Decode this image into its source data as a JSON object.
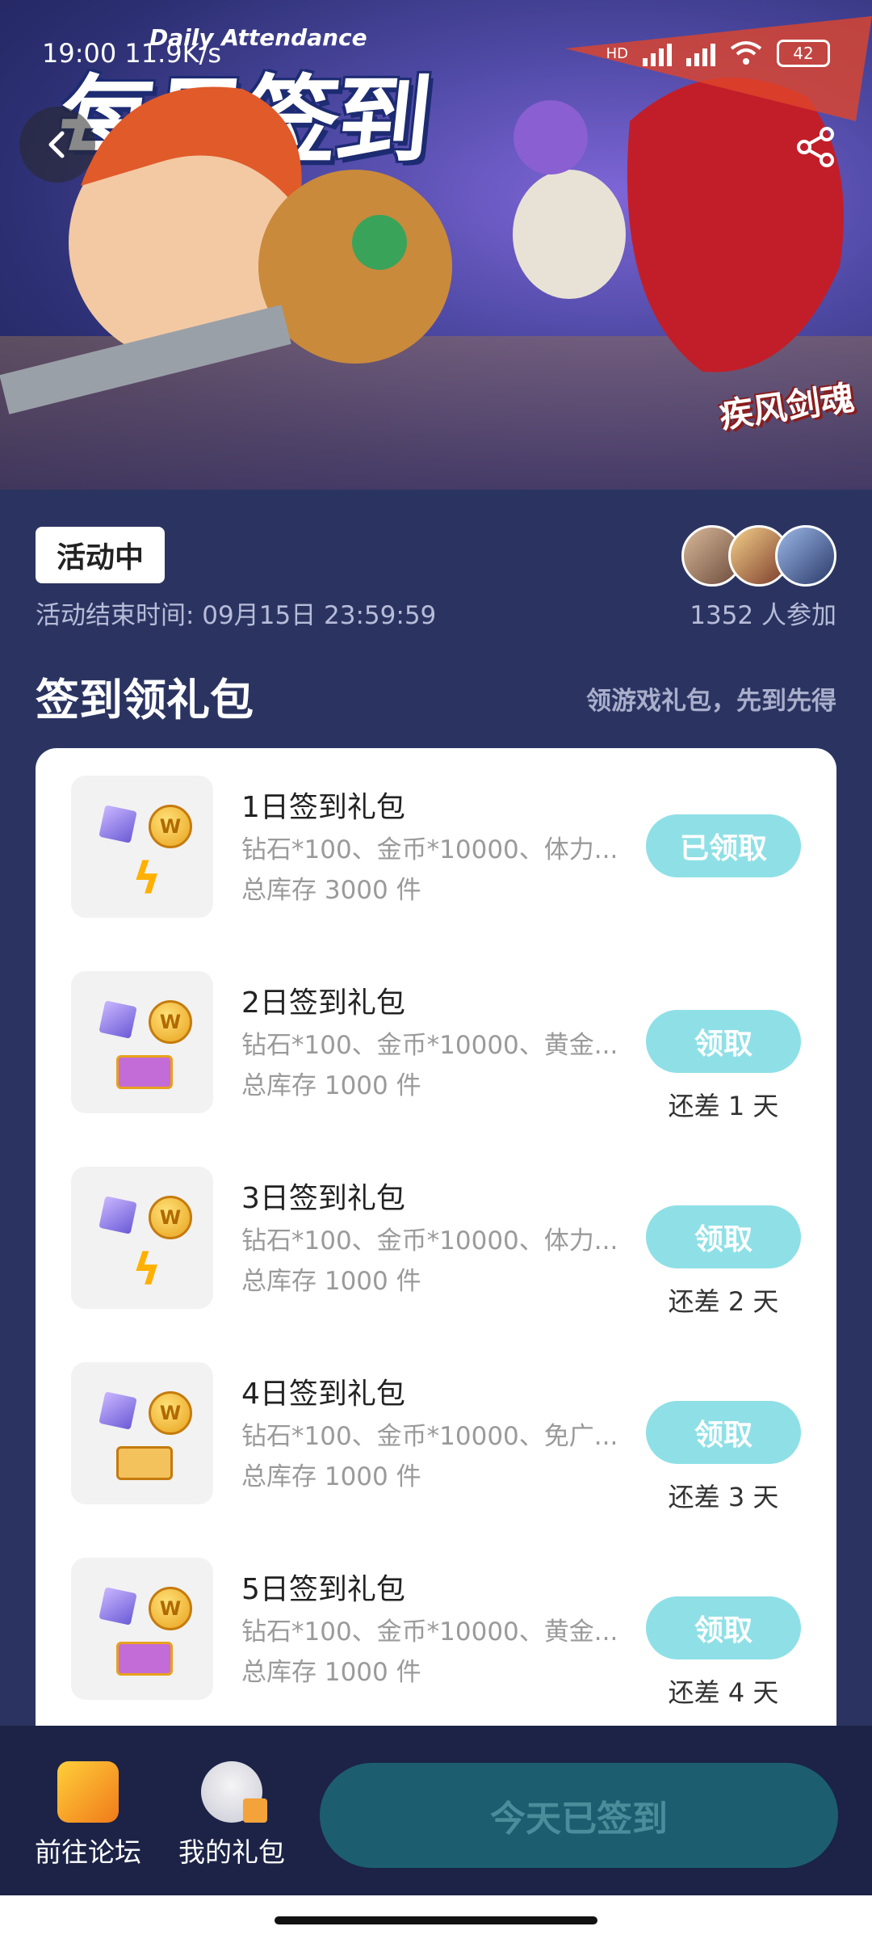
{
  "status_bar": {
    "time": "19:00",
    "speed": "11.9K/s",
    "network": "HD",
    "battery": "42"
  },
  "banner": {
    "title_en": "Daily Attendance",
    "title_cn": "每日签到",
    "game_logo": "疾风剑魂"
  },
  "activity": {
    "status_badge": "活动中",
    "end_time": "活动结束时间: 09月15日 23:59:59",
    "participants": "1352 人参加"
  },
  "section": {
    "title": "签到领礼包",
    "subtitle": "领游戏礼包，先到先得"
  },
  "gifts": [
    {
      "name": "1日签到礼包",
      "desc": "钻石*100、金币*10000、体力...",
      "stock": "总库存 3000 件",
      "button": "已领取",
      "remaining": "",
      "icon": "gem-coin-bolt-icon"
    },
    {
      "name": "2日签到礼包",
      "desc": "钻石*100、金币*10000、黄金...",
      "stock": "总库存 1000 件",
      "button": "领取",
      "remaining": "还差 1 天",
      "icon": "gem-coin-ticket-icon"
    },
    {
      "name": "3日签到礼包",
      "desc": "钻石*100、金币*10000、体力...",
      "stock": "总库存 1000 件",
      "button": "领取",
      "remaining": "还差 2 天",
      "icon": "gem-coin-bolt-icon"
    },
    {
      "name": "4日签到礼包",
      "desc": "钻石*100、金币*10000、免广...",
      "stock": "总库存 1000 件",
      "button": "领取",
      "remaining": "还差 3 天",
      "icon": "gem-coin-gold-ticket-icon"
    },
    {
      "name": "5日签到礼包",
      "desc": "钻石*100、金币*10000、黄金...",
      "stock": "总库存 1000 件",
      "button": "领取",
      "remaining": "还差 4 天",
      "icon": "gem-coin-ticket-icon"
    }
  ],
  "bottom_bar": {
    "forum_label": "前往论坛",
    "my_gifts_label": "我的礼包",
    "signed_button": "今天已签到"
  },
  "colors": {
    "background": "#2b3461",
    "button_cyan": "#8ee0e6",
    "signed_button_bg": "#1c5e6f"
  }
}
